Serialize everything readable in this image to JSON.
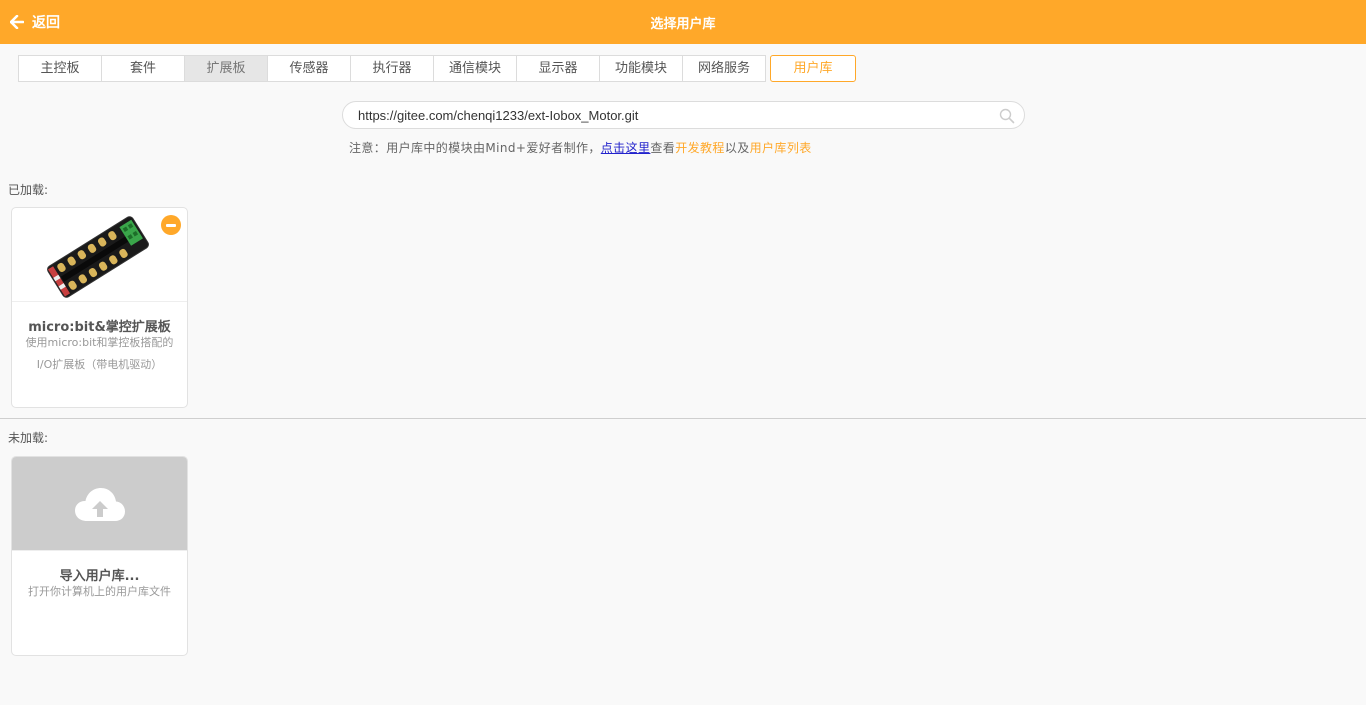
{
  "header": {
    "back_label": "返回",
    "title": "选择用户库",
    "color": "#ffa829"
  },
  "tabs": [
    {
      "label": "主控板"
    },
    {
      "label": "套件"
    },
    {
      "label": "扩展板"
    },
    {
      "label": "传感器"
    },
    {
      "label": "执行器"
    },
    {
      "label": "通信模块"
    },
    {
      "label": "显示器"
    },
    {
      "label": "功能模块"
    },
    {
      "label": "网络服务"
    },
    {
      "label": "用户库"
    }
  ],
  "search": {
    "value": "https://gitee.com/chenqi1233/ext-Iobox_Motor.git",
    "icon": "search-icon"
  },
  "notice": {
    "prefix": "注意：用户库中的模块由Mind+爱好者制作，",
    "click_here": "点击这里",
    "view": "查看",
    "dev_tutorial": "开发教程",
    "and": "以及",
    "lib_list": "用户库列表"
  },
  "loaded": {
    "label": "已加载:",
    "items": [
      {
        "title": "micro:bit&掌控扩展板",
        "desc_line1": "使用micro:bit和掌控板搭配的",
        "desc_line2": "I/O扩展板（带电机驱动）"
      }
    ]
  },
  "unloaded": {
    "label": "未加载:",
    "import_card": {
      "title": "导入用户库...",
      "desc": "打开你计算机上的用户库文件",
      "icon": "cloud-upload-icon"
    }
  }
}
